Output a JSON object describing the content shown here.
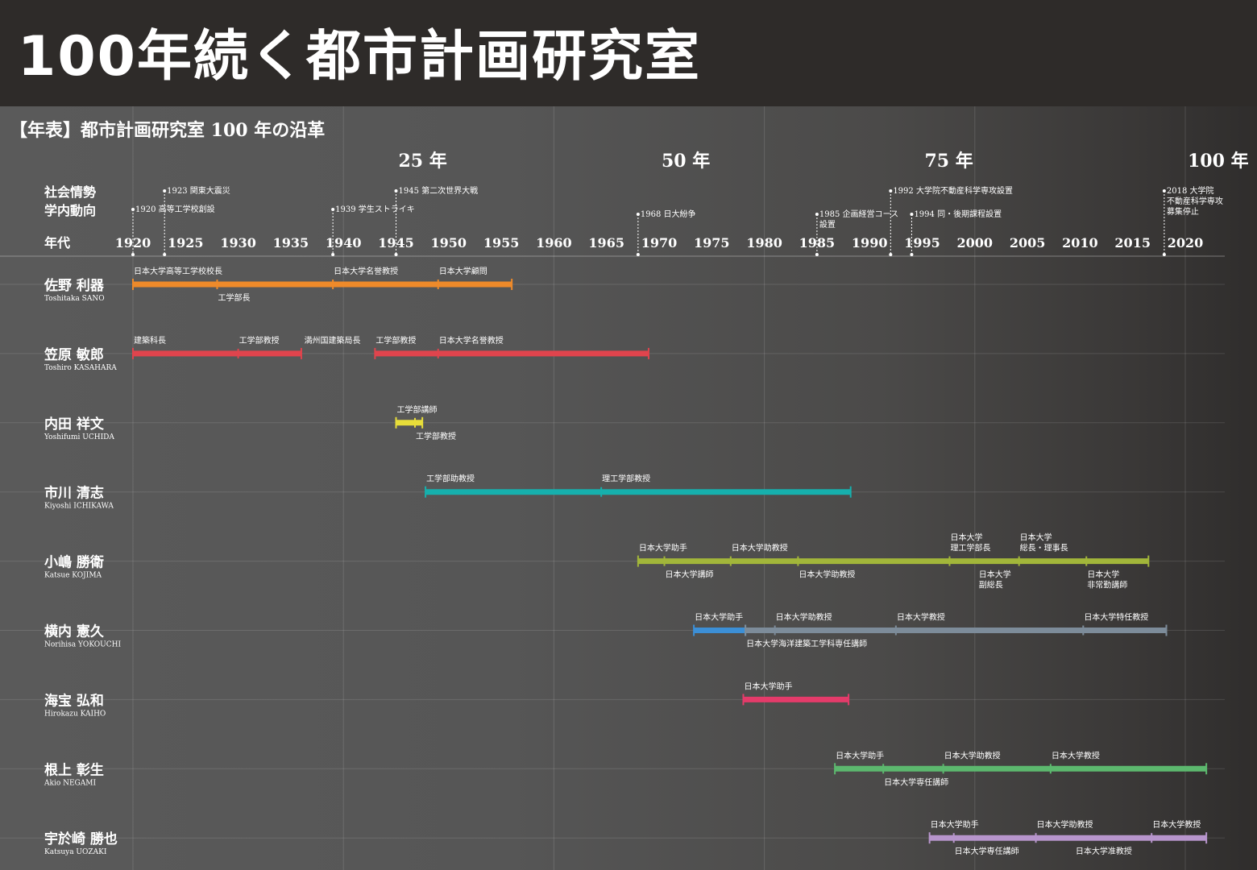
{
  "page": {
    "title": "100年続く都市計画研究室"
  },
  "chart_data": {
    "type": "timeline",
    "title": "【年表】都市計画研究室 100 年の沿革",
    "xlim": [
      1920,
      2024
    ],
    "xlabel": "年代",
    "ticks": [
      1920,
      1925,
      1930,
      1935,
      1940,
      1945,
      1950,
      1955,
      1960,
      1965,
      1970,
      1975,
      1980,
      1985,
      1990,
      1995,
      2000,
      2005,
      2010,
      2015,
      2020
    ],
    "anniversaries": [
      {
        "year": 1945,
        "label": "25 年"
      },
      {
        "year": 1970,
        "label": "50 年"
      },
      {
        "year": 1995,
        "label": "75 年"
      },
      {
        "year": 2020,
        "label": "100 年"
      }
    ],
    "event_labels": {
      "social": "社会情勢",
      "campus": "学内動向"
    },
    "events": [
      {
        "year": 1920,
        "lines": [
          "1920 高等工学校創設"
        ]
      },
      {
        "year": 1923,
        "lines": [
          "1923 関東大震災"
        ]
      },
      {
        "year": 1939,
        "lines": [
          "1939 学生ストライキ"
        ]
      },
      {
        "year": 1945,
        "lines": [
          "1945 第二次世界大戦"
        ]
      },
      {
        "year": 1968,
        "lines": [
          "1968 日大紛争"
        ]
      },
      {
        "year": 1985,
        "lines": [
          "1985 企画経営コース",
          "設置"
        ]
      },
      {
        "year": 1992,
        "lines": [
          "1992 大学院不動産科学専攻設置"
        ]
      },
      {
        "year": 1994,
        "lines": [
          "1994 同・後期課程設置"
        ]
      },
      {
        "year": 2018,
        "lines": [
          "2018 大学院",
          "不動産科学専攻",
          "募集停止"
        ]
      }
    ],
    "people": [
      {
        "name": "佐野 利器",
        "roman": "Toshitaka SANO",
        "segments": [
          {
            "from": 1920,
            "to": 1956,
            "color": "#ee8a2a"
          }
        ],
        "markers": [
          1928,
          1939,
          1949
        ],
        "above": [
          {
            "year": 1920,
            "lines": [
              "日本大学高等工学校校長"
            ]
          },
          {
            "year": 1939,
            "lines": [
              "日本大学名誉教授"
            ]
          },
          {
            "year": 1949,
            "lines": [
              "日本大学顧問"
            ]
          }
        ],
        "below": [
          {
            "year": 1928,
            "lines": [
              "工学部長"
            ]
          }
        ]
      },
      {
        "name": "笠原 敏郎",
        "roman": "Toshiro KASAHARA",
        "segments": [
          {
            "from": 1920,
            "to": 1936,
            "color": "#e0444d"
          },
          {
            "from": 1943,
            "to": 1969,
            "color": "#e0444d"
          }
        ],
        "markers": [
          1930,
          1949
        ],
        "above": [
          {
            "year": 1920,
            "lines": [
              "建築科長"
            ]
          },
          {
            "year": 1930,
            "lines": [
              "工学部教授"
            ]
          },
          {
            "year": 1936.2,
            "lines": [
              "満州国建築局長"
            ]
          },
          {
            "year": 1943,
            "lines": [
              "工学部教授"
            ]
          },
          {
            "year": 1949,
            "lines": [
              "日本大学名誉教授"
            ]
          }
        ],
        "below": []
      },
      {
        "name": "内田 祥文",
        "roman": "Yoshifumi UCHIDA",
        "segments": [
          {
            "from": 1945,
            "to": 1947.5,
            "color": "#e8de3a"
          }
        ],
        "markers": [
          1946.8
        ],
        "above": [
          {
            "year": 1945,
            "lines": [
              "工学部講師"
            ]
          }
        ],
        "below": [
          {
            "year": 1946.8,
            "lines": [
              "工学部教授"
            ]
          }
        ]
      },
      {
        "name": "市川 清志",
        "roman": "Kiyoshi ICHIKAWA",
        "segments": [
          {
            "from": 1947.8,
            "to": 1988.2,
            "color": "#16b0ad"
          }
        ],
        "markers": [
          1964.5
        ],
        "above": [
          {
            "year": 1947.8,
            "lines": [
              "工学部助教授"
            ]
          },
          {
            "year": 1964.5,
            "lines": [
              "理工学部教授"
            ]
          }
        ],
        "below": []
      },
      {
        "name": "小嶋 勝衛",
        "roman": "Katsue KOJIMA",
        "segments": [
          {
            "from": 1968,
            "to": 2016.5,
            "color": "#a2b63a"
          }
        ],
        "markers": [
          1970.5,
          1976.8,
          1983.2,
          1997.6,
          2004.2,
          2010.6
        ],
        "above": [
          {
            "year": 1968,
            "lines": [
              "日本大学助手"
            ]
          },
          {
            "year": 1976.8,
            "lines": [
              "日本大学助教授"
            ]
          },
          {
            "year": 1997.6,
            "lines": [
              "日本大学",
              "理工学部長"
            ]
          },
          {
            "year": 2004.2,
            "lines": [
              "日本大学",
              "総長・理事長"
            ]
          }
        ],
        "below": [
          {
            "year": 1970.5,
            "lines": [
              "日本大学講師"
            ]
          },
          {
            "year": 1983.2,
            "lines": [
              "日本大学助教授"
            ]
          },
          {
            "year": 2000.3,
            "lines": [
              "日本大学",
              "副総長"
            ]
          },
          {
            "year": 2010.6,
            "lines": [
              "日本大学",
              "非常勤講師"
            ]
          }
        ]
      },
      {
        "name": "横内 憲久",
        "roman": "Norihisa YOKOUCHI",
        "segments": [
          {
            "from": 1973.3,
            "to": 1978.2,
            "color": "#3c8fd6"
          },
          {
            "from": 1978.2,
            "to": 2018.2,
            "color": "#7d8c9a"
          }
        ],
        "markers": [
          1981,
          1992.5,
          2010.3
        ],
        "above": [
          {
            "year": 1973.3,
            "lines": [
              "日本大学助手"
            ]
          },
          {
            "year": 1981,
            "lines": [
              "日本大学助教授"
            ]
          },
          {
            "year": 1992.5,
            "lines": [
              "日本大学教授"
            ]
          },
          {
            "year": 2010.3,
            "lines": [
              "日本大学特任教授"
            ]
          }
        ],
        "below": [
          {
            "year": 1978.2,
            "lines": [
              "日本大学海洋建築工学科専任講師"
            ]
          }
        ]
      },
      {
        "name": "海宝 弘和",
        "roman": "Hirokazu KAIHO",
        "segments": [
          {
            "from": 1978,
            "to": 1988,
            "color": "#e43b6a"
          }
        ],
        "markers": [],
        "above": [
          {
            "year": 1978,
            "lines": [
              "日本大学助手"
            ]
          }
        ],
        "below": []
      },
      {
        "name": "根上 彰生",
        "roman": "Akio NEGAMI",
        "segments": [
          {
            "from": 1986.7,
            "to": 2022,
            "color": "#5cb86e"
          }
        ],
        "markers": [
          1991.3,
          1997,
          2007.2
        ],
        "above": [
          {
            "year": 1986.7,
            "lines": [
              "日本大学助手"
            ]
          },
          {
            "year": 1997,
            "lines": [
              "日本大学助教授"
            ]
          },
          {
            "year": 2007.2,
            "lines": [
              "日本大学教授"
            ]
          }
        ],
        "below": [
          {
            "year": 1991.3,
            "lines": [
              "日本大学専任講師"
            ]
          }
        ]
      },
      {
        "name": "宇於崎 勝也",
        "roman": "Katsuya UOZAKI",
        "segments": [
          {
            "from": 1995.7,
            "to": 2022,
            "color": "#b795cc"
          }
        ],
        "markers": [
          1998,
          2005.8,
          2016.8
        ],
        "above": [
          {
            "year": 1995.7,
            "lines": [
              "日本大学助手"
            ]
          },
          {
            "year": 2005.8,
            "lines": [
              "日本大学助教授"
            ]
          },
          {
            "year": 2016.8,
            "lines": [
              "日本大学教授"
            ]
          }
        ],
        "below": [
          {
            "year": 1998,
            "lines": [
              "日本大学専任講師"
            ]
          },
          {
            "year": 2009.5,
            "lines": [
              "日本大学准教授"
            ]
          }
        ]
      }
    ]
  }
}
